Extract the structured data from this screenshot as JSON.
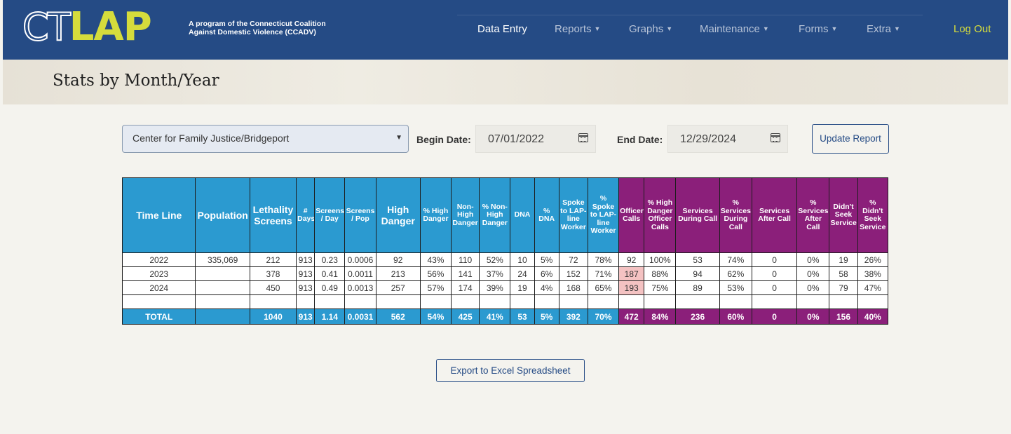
{
  "app": {
    "logo_ct": "CT",
    "logo_lap": "LAP",
    "logo_subtitle": "A program of the Connecticut Coalition Against Domestic Violence (CCADV)"
  },
  "nav": {
    "items": [
      {
        "label": "Data Entry",
        "dropdown": false,
        "active": true
      },
      {
        "label": "Reports",
        "dropdown": true
      },
      {
        "label": "Graphs",
        "dropdown": true
      },
      {
        "label": "Maintenance",
        "dropdown": true
      },
      {
        "label": "Forms",
        "dropdown": true
      },
      {
        "label": "Extra",
        "dropdown": true
      }
    ],
    "logout": "Log Out",
    "caret_icon": "caret-down-icon"
  },
  "page": {
    "title": "Stats by Month/Year"
  },
  "filters": {
    "location": "Center for Family Justice/Bridgeport",
    "begin_label": "Begin Date:",
    "begin_value": "07/01/2022",
    "end_label": "End Date:",
    "end_value": "12/29/2024",
    "update_button": "Update Report"
  },
  "table": {
    "headers": [
      {
        "label": "Time Line",
        "group": "blue"
      },
      {
        "label": "Population",
        "group": "blue"
      },
      {
        "label": "Lethality Screens",
        "group": "blue"
      },
      {
        "label": "# Days",
        "group": "blue"
      },
      {
        "label": "Screens / Day",
        "group": "blue"
      },
      {
        "label": "Screens / Pop",
        "group": "blue"
      },
      {
        "label": "High Danger",
        "group": "blue"
      },
      {
        "label": "% High Danger",
        "group": "blue"
      },
      {
        "label": "Non-High Danger",
        "group": "blue"
      },
      {
        "label": "% Non-High Danger",
        "group": "blue"
      },
      {
        "label": "DNA",
        "group": "blue"
      },
      {
        "label": "% DNA",
        "group": "blue"
      },
      {
        "label": "Spoke to LAP-line Worker",
        "group": "blue"
      },
      {
        "label": "% Spoke to LAP-line Worker",
        "group": "blue"
      },
      {
        "label": "Officer Calls",
        "group": "purple"
      },
      {
        "label": "% High Danger Officer Calls",
        "group": "purple"
      },
      {
        "label": "Services During Call",
        "group": "purple"
      },
      {
        "label": "% Services During Call",
        "group": "purple"
      },
      {
        "label": "Services After Call",
        "group": "purple"
      },
      {
        "label": "% Services After Call",
        "group": "purple"
      },
      {
        "label": "Didn't Seek Service",
        "group": "purple"
      },
      {
        "label": "% Didn't Seek Service",
        "group": "purple"
      }
    ],
    "rows": [
      [
        "2022",
        "335,069",
        "212",
        "913",
        "0.23",
        "0.0006",
        "92",
        "43%",
        "110",
        "52%",
        "10",
        "5%",
        "72",
        "78%",
        "92",
        "100%",
        "53",
        "74%",
        "0",
        "0%",
        "19",
        "26%"
      ],
      [
        "2023",
        "",
        "378",
        "913",
        "0.41",
        "0.0011",
        "213",
        "56%",
        "141",
        "37%",
        "24",
        "6%",
        "152",
        "71%",
        "187",
        "88%",
        "94",
        "62%",
        "0",
        "0%",
        "58",
        "38%"
      ],
      [
        "2024",
        "",
        "450",
        "913",
        "0.49",
        "0.0013",
        "257",
        "57%",
        "174",
        "39%",
        "19",
        "4%",
        "168",
        "65%",
        "193",
        "75%",
        "89",
        "53%",
        "0",
        "0%",
        "79",
        "47%"
      ],
      [
        "",
        "",
        "",
        "",
        "",
        "",
        "",
        "",
        "",
        "",
        "",
        "",
        "",
        "",
        "",
        "",
        "",
        "",
        "",
        "",
        "",
        ""
      ]
    ],
    "highlight_color": "#f4c2c2",
    "highlighted_cells": [
      [
        1,
        14
      ],
      [
        2,
        14
      ]
    ],
    "total": [
      "TOTAL",
      "",
      "1040",
      "913",
      "1.14",
      "0.0031",
      "562",
      "54%",
      "425",
      "41%",
      "53",
      "5%",
      "392",
      "70%",
      "472",
      "84%",
      "236",
      "60%",
      "0",
      "0%",
      "156",
      "40%"
    ]
  },
  "export_button": "Export to Excel Spreadsheet",
  "colors": {
    "navbar": "#254b85",
    "logo_accent": "#d5dc3c",
    "header_blue": "#2b9ad0",
    "header_purple": "#8b1f7a"
  }
}
